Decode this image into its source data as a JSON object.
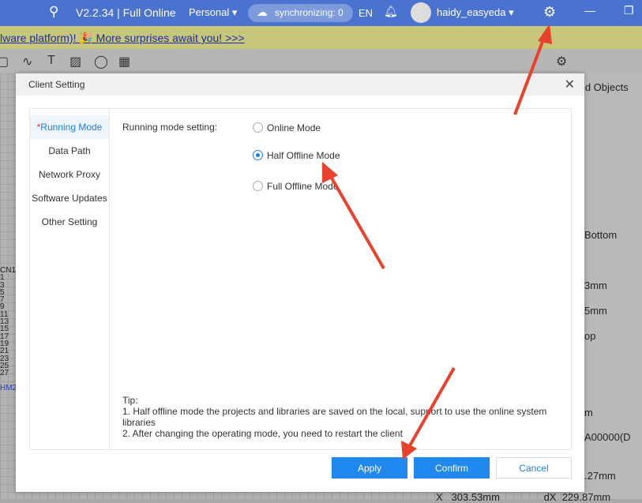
{
  "topbar": {
    "version": "V2.2.34 | Full Online",
    "workspace": "Personal",
    "sync": "synchronizing: 0",
    "lang": "EN",
    "user": "haidy_easyeda"
  },
  "banner": {
    "text": "lware platform)! 🎉 More surprises await you! >>>"
  },
  "right_panel": {
    "tab": "ted Objects",
    "layer": "Bottom",
    "w": "3mm",
    "h": "5mm",
    "side": "op",
    "unit": "m",
    "part": "A00000(D",
    "y": ".27mm",
    "x_label": "X",
    "x_value": "303.53mm",
    "dx_label": "dX",
    "dx_value": "229.87mm"
  },
  "canvas": {
    "ref1": "CN1",
    "ref2": "HM28",
    "pins": [
      "1",
      "3",
      "5",
      "7",
      "9",
      "11",
      "13",
      "15",
      "17",
      "19",
      "21",
      "23",
      "25",
      "27"
    ]
  },
  "dialog": {
    "title": "Client Setting",
    "nav": [
      {
        "label": "Running Mode",
        "required": "*"
      },
      {
        "label": "Data Path"
      },
      {
        "label": "Network Proxy"
      },
      {
        "label": "Software Updates"
      },
      {
        "label": "Other Setting"
      }
    ],
    "setting_label": "Running mode setting:",
    "options": [
      {
        "label": "Online Mode"
      },
      {
        "label": "Half Offline Mode",
        "selected": true
      },
      {
        "label": "Full Offline Mode"
      }
    ],
    "tip_title": "Tip:",
    "tip_1": "1. Half offline mode the projects and libraries are saved on the local, support to use the online system libraries",
    "tip_2": "2. After changing the operating mode, you need to restart the client",
    "apply": "Apply",
    "confirm": "Confirm",
    "cancel": "Cancel"
  },
  "colors": {
    "accent": "#2188f0",
    "topbar": "#4a72cf",
    "annotation_arrow": "#e8412c"
  }
}
